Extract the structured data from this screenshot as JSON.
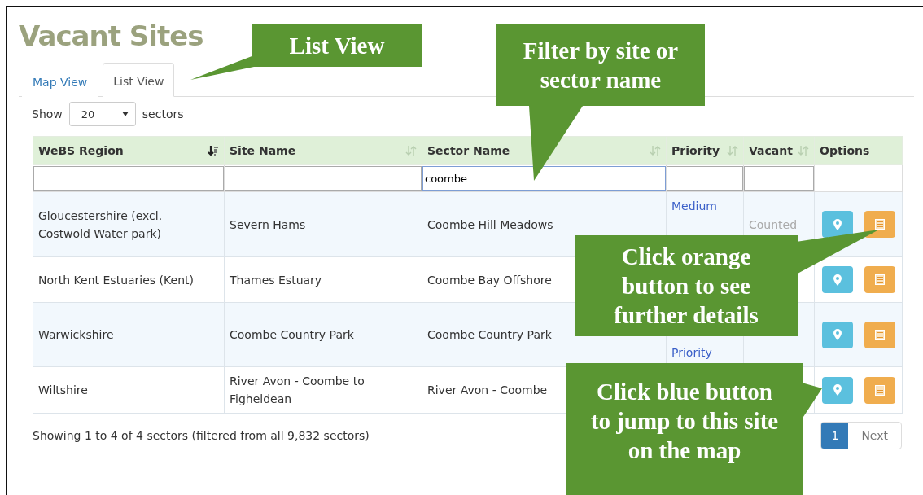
{
  "title": "Vacant Sites",
  "tabs": [
    {
      "label": "Map View",
      "selected": false
    },
    {
      "label": "List View",
      "selected": true
    }
  ],
  "length_control": {
    "label_before": "Show",
    "value": "20",
    "label_after": "sectors"
  },
  "table": {
    "columns": [
      {
        "label": "WeBS Region",
        "sorted": true
      },
      {
        "label": "Site Name",
        "sorted": false
      },
      {
        "label": "Sector Name",
        "sorted": false
      },
      {
        "label": "Priority",
        "sorted": false
      },
      {
        "label": "Vacant",
        "sorted": false
      },
      {
        "label": "Options"
      }
    ],
    "filters": [
      {
        "focused": false
      },
      {
        "focused": false
      },
      {
        "value": "coombe",
        "focused": true
      },
      {
        "focused": false
      },
      {
        "focused": false
      }
    ],
    "rows": [
      {
        "region": "Gloucestershire (excl. Costwold Water park)",
        "site": "Severn Hams",
        "sector": "Coombe Hill Meadows",
        "priority": "Medium",
        "vacant": "Counted"
      },
      {
        "region": "North Kent Estuaries (Kent)",
        "site": "Thames Estuary",
        "sector": "Coombe Bay Offshore"
      },
      {
        "region": "Warwickshire",
        "site": "Coombe Country Park",
        "sector": "Coombe Country Park",
        "priority": "Priority"
      },
      {
        "region": "Wiltshire",
        "site": "River Avon - Coombe to Figheldean",
        "sector": "River Avon - Coombe"
      }
    ]
  },
  "info": "Showing 1 to 4 of 4 sectors (filtered from all 9,832 sectors)",
  "pagination": {
    "pages": [
      {
        "label": "1",
        "selected": true
      }
    ],
    "next": "Next"
  },
  "callouts": [
    {
      "text": "List View"
    },
    {
      "text": "Filter by site or sector name"
    },
    {
      "text": "Click orange button to see further details"
    },
    {
      "text": "Click blue button to jump to this site on the map"
    }
  ]
}
